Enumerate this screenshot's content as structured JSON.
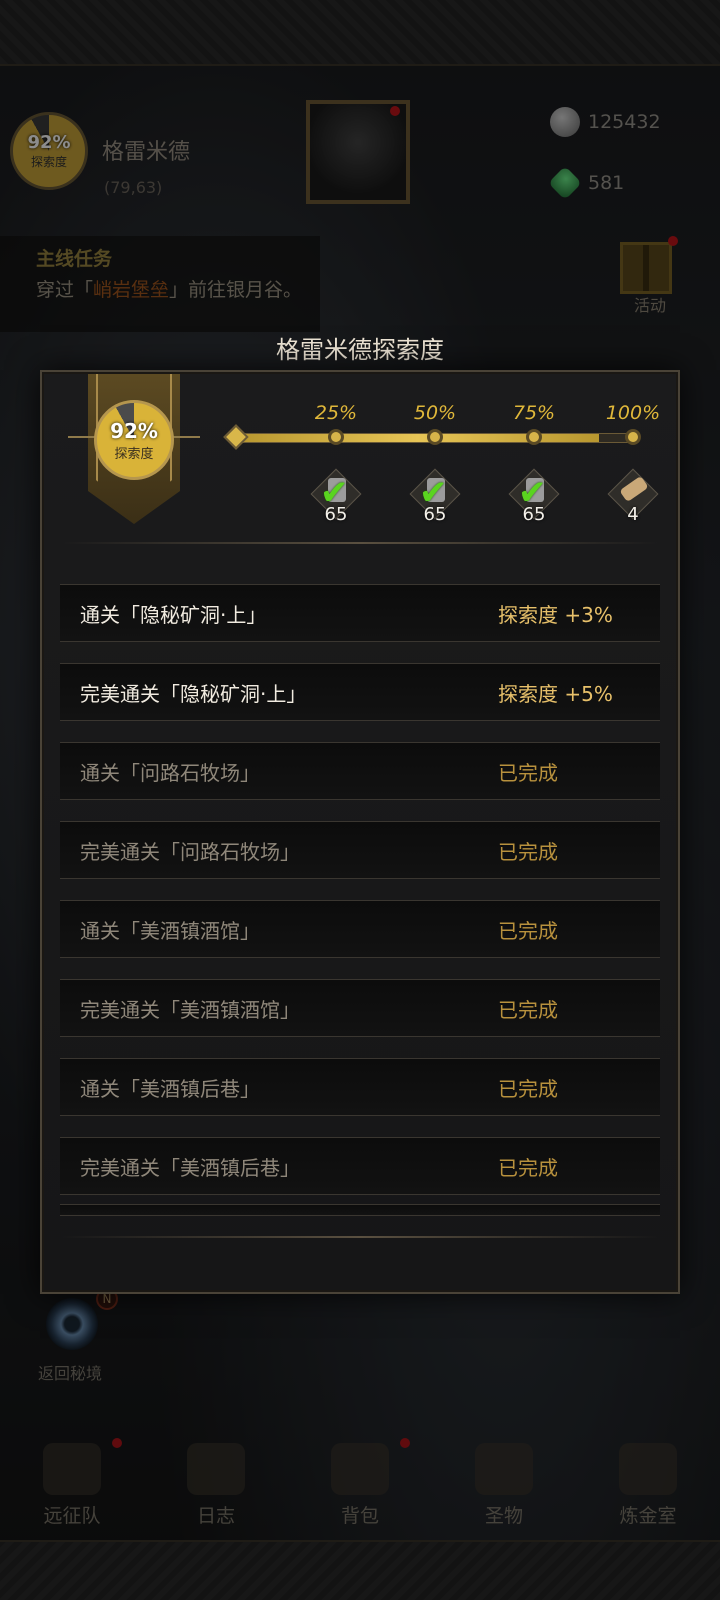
{
  "hud": {
    "exploration_pct": "92%",
    "exploration_label": "探索度",
    "region_name": "格雷米德",
    "coordinates": "(79,63)",
    "currency_silver": "125432",
    "currency_gem": "581",
    "activity_label": "活动",
    "return_label": "返回秘境",
    "return_badge": "N"
  },
  "quest": {
    "title": "主线任务",
    "desc_prefix": "穿过「",
    "desc_highlight": "峭岩堡垒",
    "desc_suffix": "」前往银月谷。"
  },
  "modal": {
    "title": "格雷米德探索度",
    "badge_pct": "92%",
    "badge_label": "探索度",
    "progress_fraction": 0.92,
    "milestones": [
      {
        "pct": "25%",
        "reward_count": "65",
        "claimed": true
      },
      {
        "pct": "50%",
        "reward_count": "65",
        "claimed": true
      },
      {
        "pct": "75%",
        "reward_count": "65",
        "claimed": true
      },
      {
        "pct": "100%",
        "reward_count": "4",
        "claimed": false
      }
    ],
    "tasks": [
      {
        "name": "通关「隐秘矿洞·上」",
        "status": "探索度 +3%",
        "done": false
      },
      {
        "name": "完美通关「隐秘矿洞·上」",
        "status": "探索度 +5%",
        "done": false
      },
      {
        "name": "通关「问路石牧场」",
        "status": "已完成",
        "done": true
      },
      {
        "name": "完美通关「问路石牧场」",
        "status": "已完成",
        "done": true
      },
      {
        "name": "通关「美酒镇酒馆」",
        "status": "已完成",
        "done": true
      },
      {
        "name": "完美通关「美酒镇酒馆」",
        "status": "已完成",
        "done": true
      },
      {
        "name": "通关「美酒镇后巷」",
        "status": "已完成",
        "done": true
      },
      {
        "name": "完美通关「美酒镇后巷」",
        "status": "已完成",
        "done": true
      }
    ]
  },
  "nav": [
    {
      "label": "远征队",
      "dot": true
    },
    {
      "label": "日志",
      "dot": false
    },
    {
      "label": "背包",
      "dot": true
    },
    {
      "label": "圣物",
      "dot": false
    },
    {
      "label": "炼金室",
      "dot": false
    }
  ],
  "colors": {
    "gold": "#e0b83a",
    "done_text": "#b8913d",
    "check_green": "#5ad41f",
    "red_dot": "#b0141b"
  }
}
